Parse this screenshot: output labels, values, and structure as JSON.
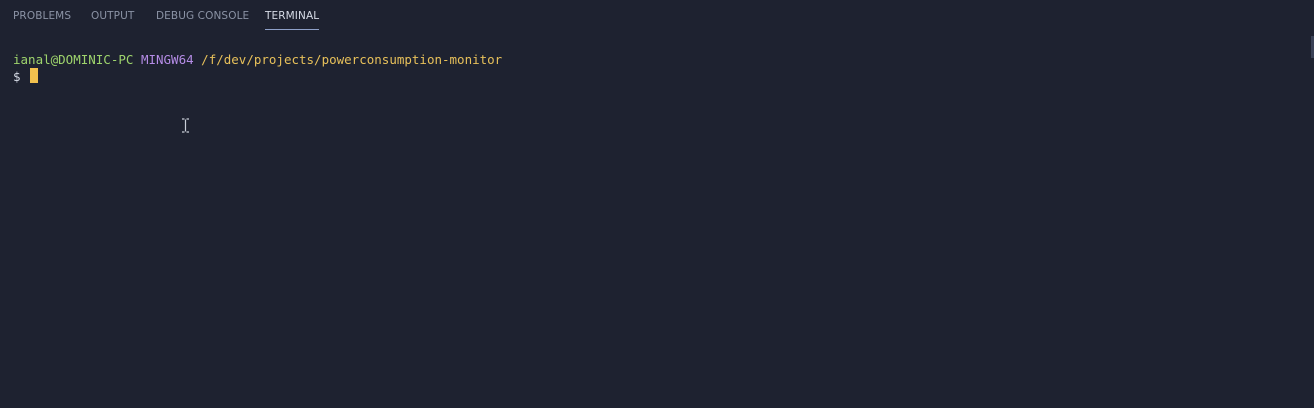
{
  "tabs": [
    {
      "label": "PROBLEMS",
      "active": false
    },
    {
      "label": "OUTPUT",
      "active": false
    },
    {
      "label": "DEBUG CONSOLE",
      "active": false
    },
    {
      "label": "TERMINAL",
      "active": true
    }
  ],
  "terminal": {
    "user_host": "ianal@DOMINIC-PC",
    "msystem": "MINGW64",
    "cwd": "/f/dev/projects/powerconsumption-monitor",
    "prompt_symbol": "$"
  },
  "colors": {
    "background": "#1e2230",
    "user_host": "#9ed46c",
    "msystem": "#b58ce6",
    "cwd": "#e7c05a",
    "cursor": "#f2c14e",
    "active_tab": "#d6dbe6",
    "inactive_tab": "#8b93a5"
  },
  "icons": {
    "mouse_pointer": "text-cursor-ibeam-icon"
  }
}
